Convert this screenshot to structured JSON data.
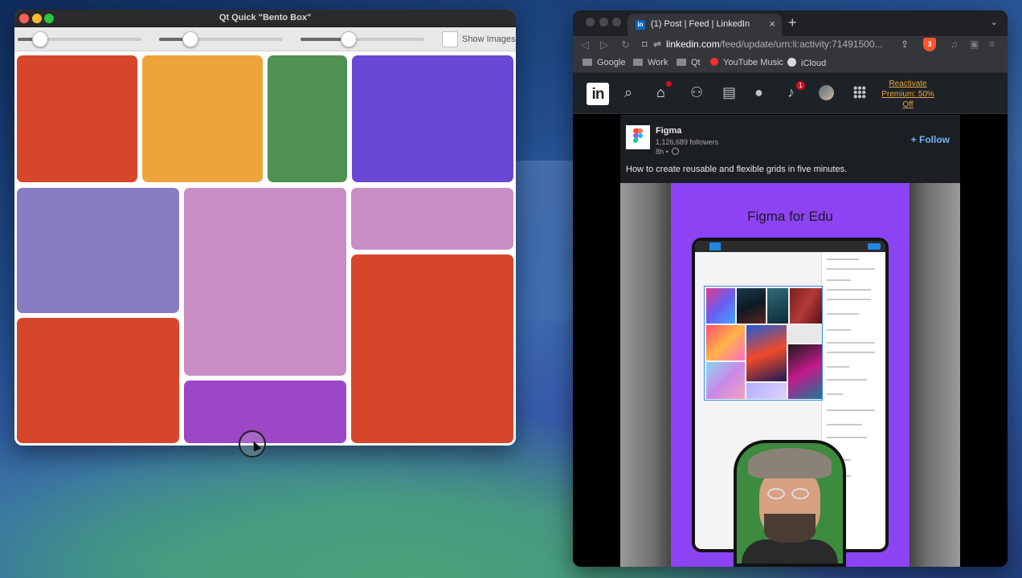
{
  "qt_window": {
    "title": "Qt Quick \"Bento Box\"",
    "sliders": [
      {
        "value": 0.18
      },
      {
        "value": 0.25
      },
      {
        "value": 0.39
      }
    ],
    "show_images_label": "Show Images",
    "show_images_checked": false,
    "tile_colors": {
      "red": "#d6462b",
      "orange": "#eda43a",
      "green": "#4f9150",
      "violet": "#6a47d4",
      "periwinkle": "#8a7cc2",
      "pink": "#c78dc4",
      "purple": "#9c46c8"
    }
  },
  "browser": {
    "tab_title": "(1) Post | Feed | LinkedIn",
    "url_host": "linkedin.com",
    "url_path": "/feed/update/urn:li:activity:71491500...",
    "bookmarks": [
      {
        "label": "Google",
        "icon": "folder-icon"
      },
      {
        "label": "Work",
        "icon": "folder-icon"
      },
      {
        "label": "Qt",
        "icon": "folder-icon"
      },
      {
        "label": "YouTube Music",
        "icon": "youtube-music-icon"
      },
      {
        "label": "iCloud",
        "icon": "icloud-icon"
      }
    ],
    "linkedin": {
      "logo_text": "in",
      "home_badge": "",
      "notifications_badge": "1",
      "premium_text": "Reactivate Premium: 50% Off"
    },
    "post": {
      "author": "Figma",
      "followers": "1,126,689 followers",
      "time": "8h •",
      "follow_label": "+ Follow",
      "text": "How to create reusable and flexible grids in five minutes.",
      "media_title": "Figma for Edu"
    }
  }
}
